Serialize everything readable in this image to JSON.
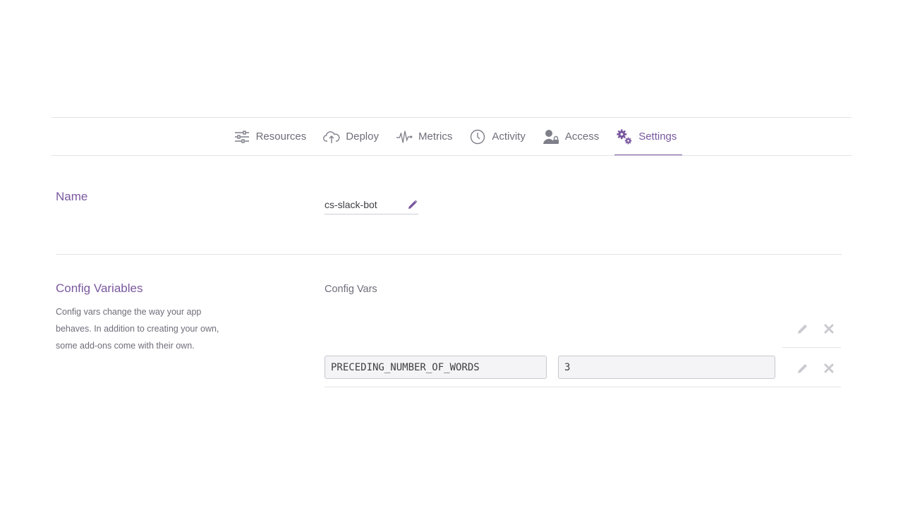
{
  "nav": {
    "tabs": [
      {
        "label": "Resources",
        "icon": "sliders-icon",
        "active": false
      },
      {
        "label": "Deploy",
        "icon": "cloud-upload-icon",
        "active": false
      },
      {
        "label": "Metrics",
        "icon": "pulse-icon",
        "active": false
      },
      {
        "label": "Activity",
        "icon": "clock-icon",
        "active": false
      },
      {
        "label": "Access",
        "icon": "user-lock-icon",
        "active": false
      },
      {
        "label": "Settings",
        "icon": "gears-icon",
        "active": true
      }
    ]
  },
  "name_section": {
    "title": "Name",
    "value": "cs-slack-bot",
    "edit_icon": "pencil-icon"
  },
  "config_section": {
    "title": "Config Variables",
    "description": "Config vars change the way your app behaves. In addition to creating your own, some add-ons come with their own.",
    "vars_label": "Config Vars",
    "vars": [
      {
        "key": "PRECEDING_NUMBER_OF_WORDS",
        "value": "3"
      }
    ],
    "edit_icon": "pencil-icon",
    "delete_icon": "close-icon"
  },
  "colors": {
    "accent": "#79589f",
    "text": "#3f3f44",
    "muted": "#6e6e7a",
    "border": "#e3e3e7",
    "disabled_icon": "#c9c9cf"
  }
}
